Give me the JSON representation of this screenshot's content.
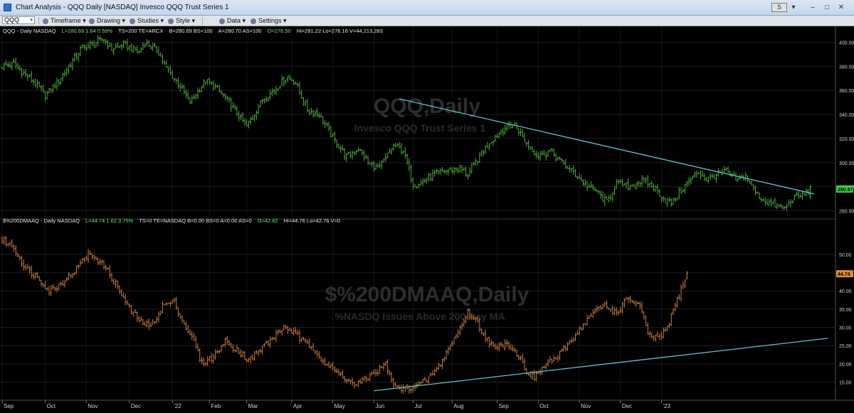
{
  "window": {
    "title": "Chart Analysis - QQQ Daily [NASDAQ] Invesco QQQ Trust Series 1",
    "controls": [
      "–",
      "□",
      "✕"
    ],
    "s_badge": "S"
  },
  "toolbar": {
    "symbol": "QQQ",
    "timeframe": "Timeframe",
    "drawing": "Drawing",
    "studies": "Studies",
    "style": "Style",
    "data": "Data",
    "settings": "Settings"
  },
  "panels": {
    "top": {
      "header_parts": [
        {
          "text": "QQQ - Daily  NASDAQ",
          "color": "#e6e6e6"
        },
        {
          "text": "L=280.69  1.64  0.59%",
          "color": "#6fe36f"
        },
        {
          "text": "TS=200   TE=ARCX",
          "color": "#e6e6e6"
        },
        {
          "text": "B=280.69  BS=100",
          "color": "#e6e6e6"
        },
        {
          "text": "A=280.70  AS=100",
          "color": "#e6e6e6"
        },
        {
          "text": "O=276.50",
          "color": "#6fe36f"
        },
        {
          "text": "Hi=281.22  Lo=276.16  V=44,213,283",
          "color": "#e6e6e6"
        }
      ],
      "watermark_title": "QQQ,Daily",
      "watermark_subtitle": "Invesco QQQ Trust Series 1",
      "last_price_tag": "280.97",
      "color": "#4fa83a",
      "accent": "#3fd03f"
    },
    "bottom": {
      "header_parts": [
        {
          "text": "$%200DMAAQ - Daily  NASDAQ",
          "color": "#e6e6e6"
        },
        {
          "text": "L=44.74  1.62  3.75%",
          "color": "#6fe36f"
        },
        {
          "text": "TS=0  TE=NASDAQ  B=0.00  BS=0  A=0.00  AS=0",
          "color": "#e6e6e6"
        },
        {
          "text": "O=42.82",
          "color": "#6fe36f"
        },
        {
          "text": "Hi=44.76  Lo=42.76  V=0",
          "color": "#e6e6e6"
        }
      ],
      "watermark_title": "$%200DMAAQ,Daily",
      "watermark_subtitle": "%NASDQ Issues Above 200 Day MA",
      "last_price_tag": "44.74",
      "color": "#c77a3d",
      "accent": "#e58a2e"
    }
  },
  "trendline_color": "#5fc3d3",
  "chart_data": [
    {
      "type": "ohlc",
      "title": "QQQ - Daily",
      "ylim": [
        255,
        405
      ],
      "y_ticks": [
        "400.00",
        "380.00",
        "360.00",
        "340.00",
        "320.00",
        "300.00",
        "280.00",
        "260.00"
      ],
      "y_tick_values": [
        400,
        380,
        360,
        340,
        320,
        300,
        280,
        260
      ],
      "anchors": [
        [
          0,
          380
        ],
        [
          6,
          382
        ],
        [
          10,
          376
        ],
        [
          17,
          366
        ],
        [
          22,
          356
        ],
        [
          28,
          366
        ],
        [
          40,
          394
        ],
        [
          52,
          403
        ],
        [
          56,
          394
        ],
        [
          62,
          398
        ],
        [
          70,
          392
        ],
        [
          73,
          400
        ],
        [
          80,
          392
        ],
        [
          84,
          378
        ],
        [
          90,
          366
        ],
        [
          96,
          350
        ],
        [
          104,
          368
        ],
        [
          110,
          362
        ],
        [
          116,
          350
        ],
        [
          125,
          330
        ],
        [
          133,
          352
        ],
        [
          140,
          362
        ],
        [
          146,
          372
        ],
        [
          150,
          366
        ],
        [
          156,
          344
        ],
        [
          162,
          340
        ],
        [
          170,
          318
        ],
        [
          176,
          305
        ],
        [
          182,
          312
        ],
        [
          188,
          298
        ],
        [
          193,
          296
        ],
        [
          200,
          314
        ],
        [
          205,
          310
        ],
        [
          210,
          282
        ],
        [
          214,
          283
        ],
        [
          220,
          290
        ],
        [
          226,
          293
        ],
        [
          234,
          295
        ],
        [
          238,
          290
        ],
        [
          246,
          310
        ],
        [
          252,
          322
        ],
        [
          258,
          330
        ],
        [
          262,
          332
        ],
        [
          268,
          316
        ],
        [
          274,
          306
        ],
        [
          280,
          310
        ],
        [
          286,
          300
        ],
        [
          292,
          292
        ],
        [
          298,
          282
        ],
        [
          304,
          276
        ],
        [
          309,
          267
        ],
        [
          314,
          283
        ],
        [
          320,
          280
        ],
        [
          328,
          285
        ],
        [
          334,
          278
        ],
        [
          338,
          270
        ],
        [
          342,
          266
        ],
        [
          350,
          283
        ],
        [
          356,
          292
        ],
        [
          360,
          286
        ],
        [
          365,
          290
        ],
        [
          370,
          293
        ],
        [
          376,
          285
        ],
        [
          380,
          289
        ],
        [
          384,
          278
        ],
        [
          388,
          270
        ],
        [
          394,
          265
        ],
        [
          400,
          262
        ],
        [
          404,
          270
        ],
        [
          410,
          274
        ],
        [
          413,
          278
        ]
      ],
      "x_ticks": [
        {
          "i": 0,
          "label": "Sep"
        },
        {
          "i": 22,
          "label": "Oct"
        },
        {
          "i": 43,
          "label": "Nov"
        },
        {
          "i": 65,
          "label": "Dec"
        },
        {
          "i": 87,
          "label": "'22"
        },
        {
          "i": 106,
          "label": "Feb"
        },
        {
          "i": 125,
          "label": "Mar"
        },
        {
          "i": 148,
          "label": "Apr"
        },
        {
          "i": 169,
          "label": "May"
        },
        {
          "i": 190,
          "label": "Jun"
        },
        {
          "i": 210,
          "label": "Jul"
        },
        {
          "i": 230,
          "label": "Aug"
        },
        {
          "i": 253,
          "label": "Sep"
        },
        {
          "i": 274,
          "label": "Oct"
        },
        {
          "i": 295,
          "label": "Nov"
        },
        {
          "i": 316,
          "label": "Dec"
        },
        {
          "i": 337,
          "label": "'23"
        }
      ],
      "trendline": [
        [
          203,
          353
        ],
        [
          415,
          274
        ]
      ]
    },
    {
      "type": "ohlc",
      "title": "$%200DMAAQ - Daily",
      "ylim": [
        11,
        57
      ],
      "y_ticks": [
        "50.00",
        "45.00",
        "40.00",
        "35.00",
        "30.00",
        "25.00",
        "20.00",
        "15.00"
      ],
      "y_tick_values": [
        50,
        45,
        40,
        35,
        30,
        25,
        20,
        15
      ],
      "anchors": [
        [
          0,
          54
        ],
        [
          6,
          52
        ],
        [
          12,
          46
        ],
        [
          18,
          44
        ],
        [
          24,
          40
        ],
        [
          30,
          42
        ],
        [
          38,
          46
        ],
        [
          44,
          50
        ],
        [
          48,
          49
        ],
        [
          52,
          47
        ],
        [
          58,
          42
        ],
        [
          64,
          36
        ],
        [
          70,
          32
        ],
        [
          76,
          30
        ],
        [
          82,
          36
        ],
        [
          88,
          37
        ],
        [
          92,
          32
        ],
        [
          98,
          26
        ],
        [
          102,
          20
        ],
        [
          108,
          22
        ],
        [
          114,
          26
        ],
        [
          120,
          24
        ],
        [
          126,
          21
        ],
        [
          132,
          24
        ],
        [
          138,
          27
        ],
        [
          144,
          30
        ],
        [
          148,
          29
        ],
        [
          154,
          26
        ],
        [
          160,
          24
        ],
        [
          165,
          20
        ],
        [
          170,
          18
        ],
        [
          176,
          16
        ],
        [
          180,
          14
        ],
        [
          186,
          16
        ],
        [
          192,
          18
        ],
        [
          196,
          20
        ],
        [
          200,
          14
        ],
        [
          205,
          13
        ],
        [
          212,
          14
        ],
        [
          218,
          16
        ],
        [
          224,
          20
        ],
        [
          230,
          26
        ],
        [
          234,
          30
        ],
        [
          238,
          34
        ],
        [
          242,
          32
        ],
        [
          246,
          28
        ],
        [
          252,
          24
        ],
        [
          258,
          26
        ],
        [
          264,
          22
        ],
        [
          268,
          18
        ],
        [
          272,
          16
        ],
        [
          278,
          20
        ],
        [
          284,
          22
        ],
        [
          290,
          26
        ],
        [
          296,
          30
        ],
        [
          302,
          34
        ],
        [
          308,
          36
        ],
        [
          314,
          34
        ],
        [
          320,
          38
        ],
        [
          326,
          36
        ],
        [
          330,
          28
        ],
        [
          336,
          27
        ],
        [
          340,
          30
        ],
        [
          344,
          36
        ],
        [
          348,
          42
        ],
        [
          350,
          44.7
        ]
      ],
      "x_ticks": [],
      "trendline": [
        [
          190,
          12.6
        ],
        [
          422,
          27
        ]
      ]
    }
  ]
}
